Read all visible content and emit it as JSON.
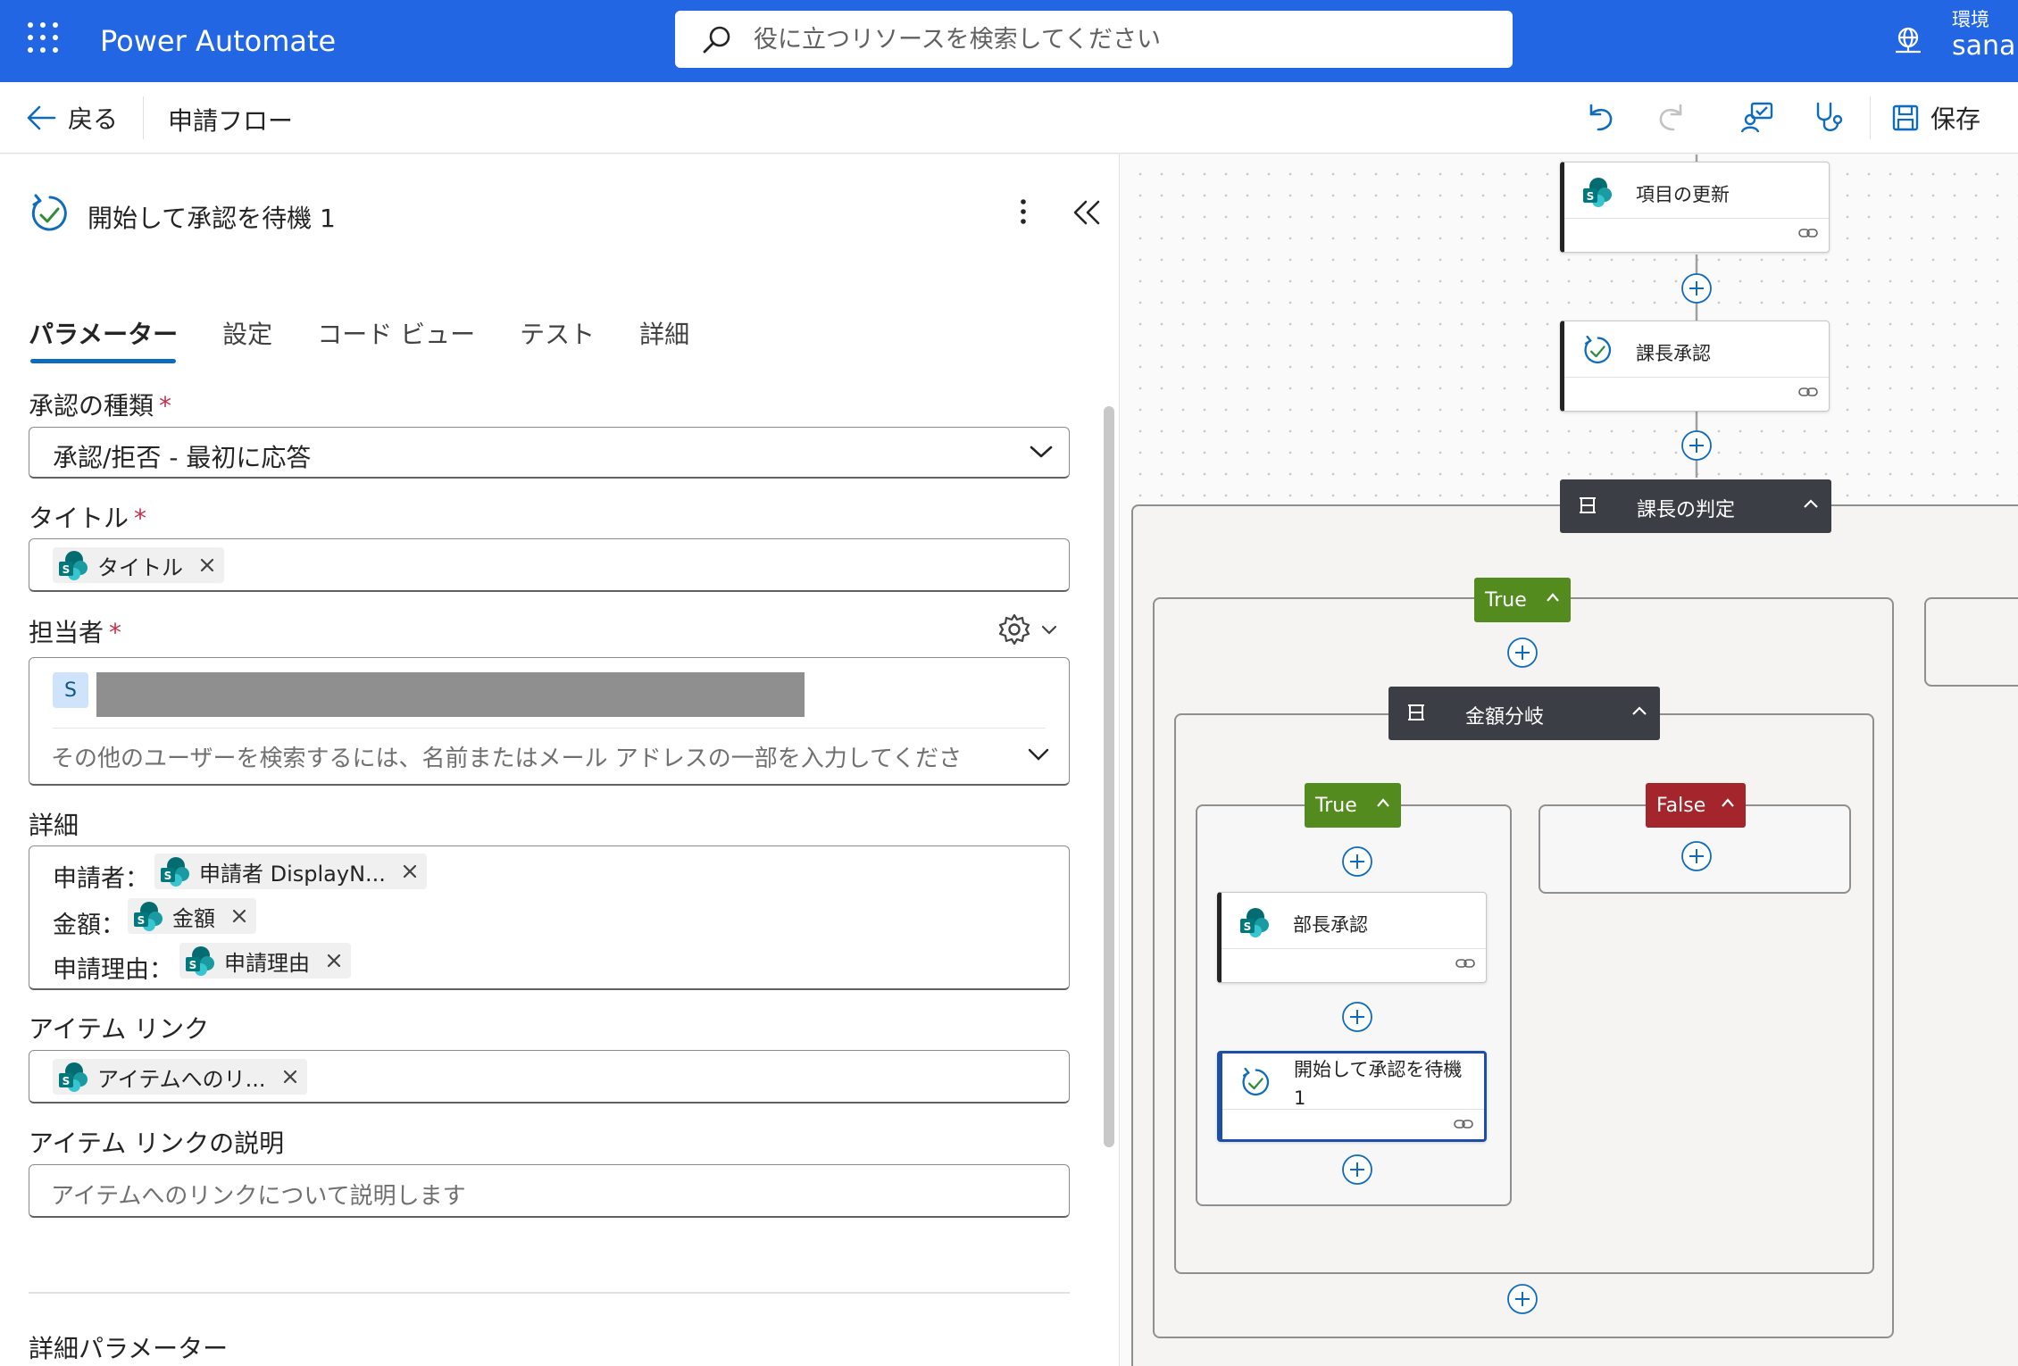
{
  "topbar": {
    "app_title": "Power Automate",
    "search_placeholder": "役に立つリソースを検索してください",
    "env_label": "環境",
    "env_name": "sanan",
    "bg_color": "#2266e3"
  },
  "cmdbar": {
    "back_label": "戻る",
    "flow_name": "申請フロー",
    "save_label": "保存"
  },
  "panel": {
    "title": "開始して承認を待機 1",
    "tabs": [
      "パラメーター",
      "設定",
      "コード ビュー",
      "テスト",
      "詳細"
    ],
    "approval_type_label": "承認の種類",
    "approval_type_value": "承認/拒否 - 最初に応答",
    "title_label": "タイトル",
    "title_token": "タイトル",
    "assignee_label": "担当者",
    "assignee_initial": "S",
    "assignee_placeholder": "その他のユーザーを検索するには、名前またはメール アドレスの一部を入力してくださ",
    "details_label": "詳細",
    "details_lines": [
      {
        "prefix": "申請者：",
        "token": "申請者 DisplayN..."
      },
      {
        "prefix": "金額：",
        "token": "金額"
      },
      {
        "prefix": "申請理由：",
        "token": "申請理由"
      }
    ],
    "item_link_label": "アイテム リンク",
    "item_link_token": "アイテムへのリ...",
    "item_link_desc_label": "アイテム リンクの説明",
    "item_link_desc_placeholder": "アイテムへのリンクについて説明します",
    "advanced_label": "詳細パラメーター",
    "required_mark": "*"
  },
  "canvas": {
    "card_update": "項目の更新",
    "card_section_approval": "課長承認",
    "cond_section_decision": "課長の判定",
    "branch_true": "True",
    "branch_false": "False",
    "cond_amount": "金額分岐",
    "card_director_approval": "部長承認",
    "card_start_wait": "開始して承認を待機 1"
  }
}
